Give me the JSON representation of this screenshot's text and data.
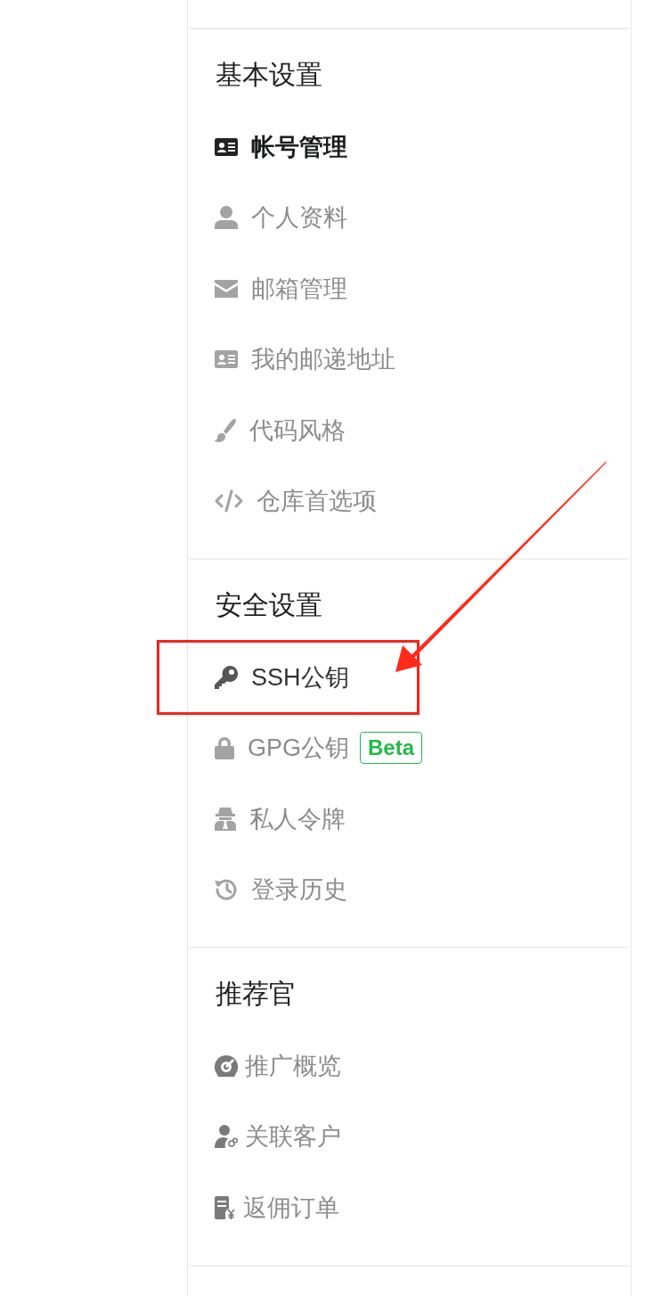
{
  "sidebar": {
    "sections": [
      {
        "heading": "基本设置",
        "items": [
          {
            "label": "帐号管理",
            "selected": true,
            "hovered": false,
            "annotated": false
          },
          {
            "label": "个人资料",
            "selected": false,
            "hovered": false,
            "annotated": false
          },
          {
            "label": "邮箱管理",
            "selected": false,
            "hovered": false,
            "annotated": false
          },
          {
            "label": "我的邮递地址",
            "selected": false,
            "hovered": false,
            "annotated": false
          },
          {
            "label": "代码风格",
            "selected": false,
            "hovered": false,
            "annotated": false
          },
          {
            "label": "仓库首选项",
            "selected": false,
            "hovered": false,
            "annotated": false
          }
        ]
      },
      {
        "heading": "安全设置",
        "items": [
          {
            "label": "SSH公钥",
            "selected": false,
            "hovered": true,
            "annotated": true
          },
          {
            "label": "GPG公钥",
            "selected": false,
            "hovered": false,
            "annotated": false,
            "badge": "Beta"
          },
          {
            "label": "私人令牌",
            "selected": false,
            "hovered": false,
            "annotated": false
          },
          {
            "label": "登录历史",
            "selected": false,
            "hovered": false,
            "annotated": false
          }
        ]
      },
      {
        "heading": "推荐官",
        "items": [
          {
            "label": "推广概览",
            "selected": false,
            "hovered": false,
            "annotated": false
          },
          {
            "label": "关联客户",
            "selected": false,
            "hovered": false,
            "annotated": false
          },
          {
            "label": "返佣订单",
            "selected": false,
            "hovered": false,
            "annotated": false
          }
        ]
      }
    ]
  }
}
